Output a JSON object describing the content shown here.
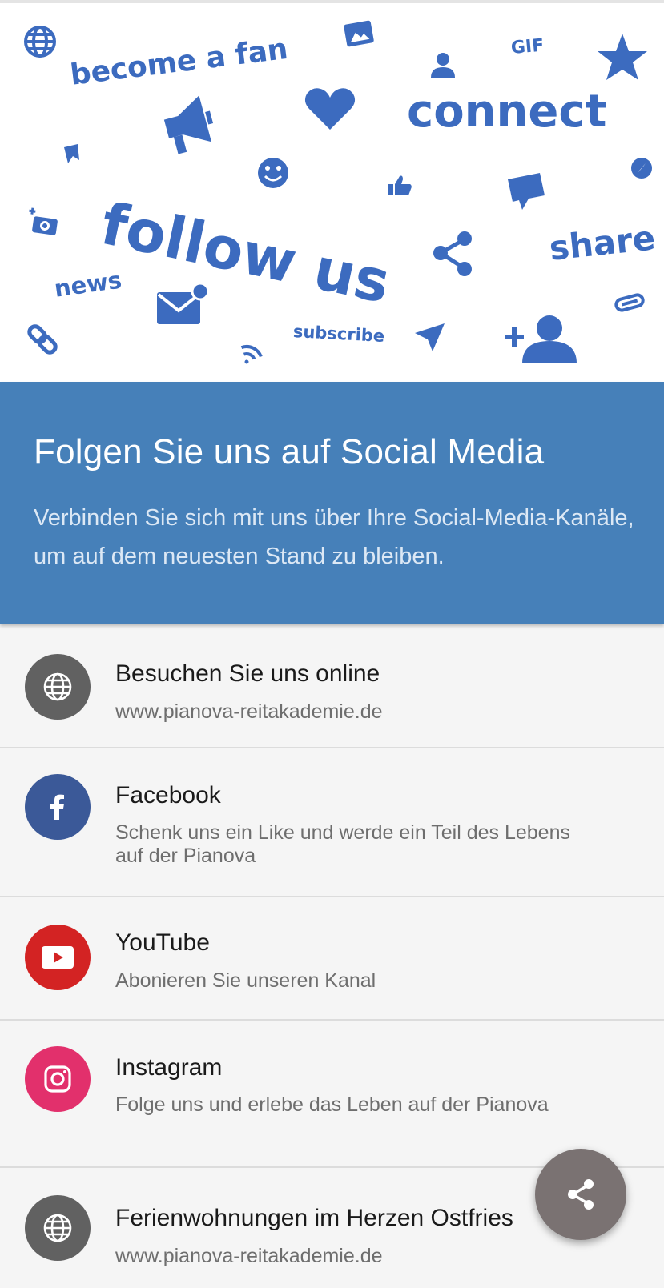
{
  "hero": {
    "words": {
      "become_a_fan": "become a fan",
      "gif": "GIF",
      "connect": "connect",
      "follow_us": "follow us",
      "share": "share",
      "news": "news",
      "subscribe": "subscribe"
    },
    "icon_color": "#3c6bbf"
  },
  "banner": {
    "title": "Folgen Sie uns auf Social Media",
    "subtitle": "Verbinden Sie sich mit uns über Ihre Social-Media-Kanäle, um auf dem neuesten Stand zu bleiben.",
    "background": "#4680b9"
  },
  "links": [
    {
      "title": "Besuchen Sie uns online",
      "subtitle": "www.pianova-reitakademie.de",
      "icon": "globe-icon",
      "color": "#616161"
    },
    {
      "title": "Facebook",
      "subtitle": "Schenk uns ein Like und werde ein Teil des Lebens auf der Pianova",
      "icon": "facebook-icon",
      "color": "#3b5998"
    },
    {
      "title": "YouTube",
      "subtitle": "Abonieren Sie unseren Kanal",
      "icon": "youtube-icon",
      "color": "#d32323"
    },
    {
      "title": "Instagram",
      "subtitle": "Folge uns und erlebe das Leben auf der Pianova",
      "icon": "instagram-icon",
      "color": "#e2306c"
    },
    {
      "title": "Ferienwohnungen im Herzen Ostfries",
      "subtitle": "www.pianova-reitakademie.de",
      "icon": "globe-icon",
      "color": "#616161"
    }
  ],
  "fab": {
    "icon": "share-icon",
    "color": "#7a7272"
  }
}
